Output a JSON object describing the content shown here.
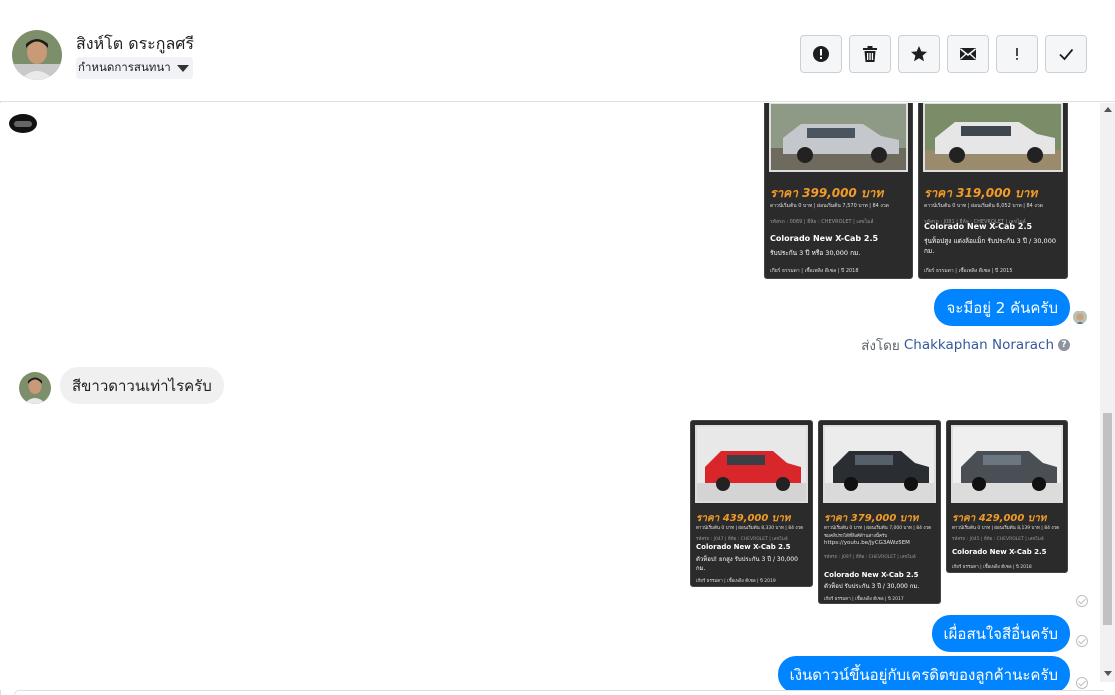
{
  "header": {
    "contact_name": "สิงห์โต ดระกูลศรี",
    "label_select": "กำหนดการสนทนา",
    "actions": [
      {
        "name": "spam-button",
        "icon": "alert-circle-icon"
      },
      {
        "name": "delete-button",
        "icon": "trash-icon"
      },
      {
        "name": "star-button",
        "icon": "star-icon"
      },
      {
        "name": "mark-unread-button",
        "icon": "envelope-icon"
      },
      {
        "name": "follow-up-button",
        "icon": "exclamation-icon"
      },
      {
        "name": "mark-done-button",
        "icon": "check-icon"
      }
    ]
  },
  "colors": {
    "accent": "#0084ff",
    "price": "#f29b27",
    "card_bg": "#2b2b2b"
  },
  "cards_top": [
    {
      "price": "ราคา 399,000 บาท",
      "sub": "ดาวน์เริ่มต้น 0 บาท | ผ่อนเริ่มต้น 7,570 บาท | 84 งวด",
      "meta": "รหัสรถ : 0069 | ยี่ห้อ : CHEVROLET | เลขไมล์",
      "model": "Colorado New X-Cab 2.5",
      "desc": "รับประกัน 3 ปี หรือ 30,000 กม.",
      "foot": "เกียร์ ธรรมดา | เชื้อเพลิง ดีเซล | ปี 2018"
    },
    {
      "price": "ราคา 319,000 บาท",
      "sub": "ดาวน์เริ่มต้น 0 บาท | ผ่อนเริ่มต้น 6,052 บาท | 84 งวด",
      "meta": "รหัสรถ : J081 | ยี่ห้อ : CHEVROLET | เลขไมล์",
      "model": "Colorado New X-Cab 2.5",
      "desc": "รุ่นท็อปสูง แต่งล้อแม็ก รับประกัน 3 ปี / 30,000 กม.",
      "foot": "เกียร์ ธรรมดา | เชื้อเพลิง ดีเซล | ปี 2015"
    }
  ],
  "messages": {
    "out_1": "จะมีอยู่ 2 คันครับ",
    "sent_by_prefix": "ส่งโดย",
    "sent_by_name": "Chakkaphan Norarach",
    "in_1": "สีขาวดาวนเท่าไรครับ",
    "out_2": "เผื่อสนใจสีอื่นครับ",
    "out_3": "เงินดาวน์ขึ้นอยู่กับเครดิตของลูกค้านะครับ"
  },
  "cards_bottom": [
    {
      "price": "ราคา 439,000 บาท",
      "sub": "ดาวน์เริ่มต้น 0 บาท | ผ่อนเริ่มต้น 8,330 บาท | 84 งวด",
      "meta": "รหัสรถ : J047 | ยี่ห้อ : CHEVROLET | เลขไมล์",
      "model": "Colorado New X-Cab 2.5",
      "desc": "ตัวท็อป! ยกสูง รับประกัน 3 ปี / 30,000 กม.",
      "foot": "เกียร์ ธรรมดา | เชื้อเพลิง ดีเซล | ปี 2019"
    },
    {
      "price": "ราคา 379,000 บาท",
      "sub": "ดาวน์เริ่มต้น 0 บาท | ผ่อนเริ่มต้น 7,000 บาท | 84 งวด",
      "extra1": "ชมคลิปรถได้ที่ลิงค์ด้านล่างนี้ครับ",
      "extra2": "https://youtu.be/JyCG3AWz5EM",
      "meta": "รหัสรถ : J097 | ยี่ห้อ : CHEVROLET | เลขไมล์",
      "model": "Colorado New X-Cab 2.5",
      "desc": "ตัวท็อป รับประกัน 3 ปี / 30,000 กม.",
      "foot": "เกียร์ ธรรมดา | เชื้อเพลิง ดีเซล | ปี 2017"
    },
    {
      "price": "ราคา 429,000 บาท",
      "sub": "ดาวน์เริ่มต้น 0 บาท | ผ่อนเริ่มต้น 8,139 บาท | 84 งวด",
      "meta": "รหัสรถ : J045 | ยี่ห้อ : CHEVROLET | เลขไมล์",
      "model": "Colorado New X-Cab 2.5",
      "foot": "เกียร์ ธรรมดา | เชื้อเพลิง ดีเซล | ปี 2018"
    }
  ]
}
